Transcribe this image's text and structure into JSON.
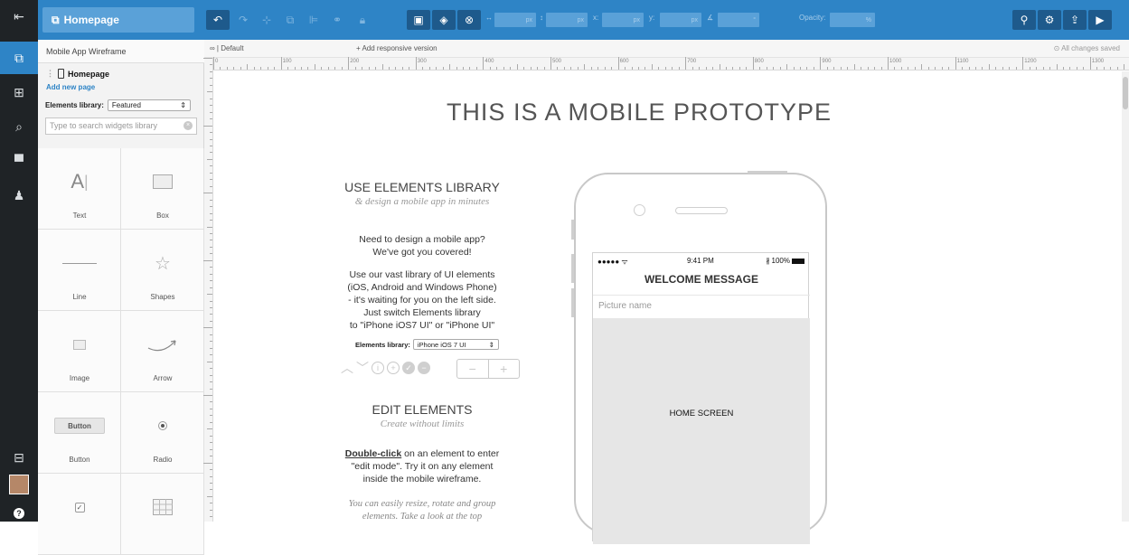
{
  "app": {
    "page_button": "Homepage",
    "project_title": "Mobile App Wireframe",
    "page_name": "Homepage",
    "add_page": "Add new page"
  },
  "toolbar": {
    "units": [
      "px",
      "px",
      "px",
      "px"
    ],
    "labels": {
      "x": "x:",
      "y": "y:",
      "opacity": "Opacity:",
      "percent": "%"
    }
  },
  "library": {
    "label": "Elements library:",
    "selected": "Featured",
    "search_placeholder": "Type to search widgets library",
    "widgets": [
      "Text",
      "Box",
      "Line",
      "Shapes",
      "Image",
      "Arrow",
      "Button",
      "Radio"
    ],
    "button_widget_label": "Button"
  },
  "canvas_head": {
    "default_tab": "∞ | Default",
    "add_responsive": "+ Add responsive version",
    "saved": "All changes saved"
  },
  "ruler": [
    "0",
    "100",
    "200",
    "300",
    "400",
    "500",
    "600",
    "700",
    "800",
    "900",
    "1000",
    "1100",
    "1200",
    "1300"
  ],
  "canvas": {
    "headline": "THIS IS A MOBILE  PROTOTYPE",
    "sec1_title": "USE ELEMENTS LIBRARY",
    "sec1_sub": "& design a mobile app in minutes",
    "sec1_p1_a": "Need to design a mobile app?",
    "sec1_p1_b": "We've got you covered!",
    "sec1_p2_a": "Use our vast library of UI elements",
    "sec1_p2_b": "(iOS, Android and Windows Phone)",
    "sec1_p2_c": "- it's waiting for you on the left side.",
    "sec1_p2_d": "Just switch Elements library",
    "sec1_p2_e": "to \"iPhone iOS7 UI\" or \"iPhone UI\"",
    "lib_label": "Elements library:",
    "lib_value": "iPhone iOS 7 UI",
    "sec2_title": "EDIT ELEMENTS",
    "sec2_sub": "Create without limits",
    "sec2_p1_bold": "Double-click",
    "sec2_p1_a": " on an element to enter",
    "sec2_p1_b": "\"edit mode\". Try it on any element",
    "sec2_p1_c": "inside the mobile wireframe.",
    "sec2_p2_a": "You can easily resize, rotate and group",
    "sec2_p2_b": "elements. Take a look at the top"
  },
  "phone": {
    "signal": "●●●●● ᯤ",
    "time": "9:41 PM",
    "battery": "100%",
    "welcome": "WELCOME MESSAGE",
    "picture_name": "Picture name",
    "home": "HOME SCREEN"
  },
  "colors": {
    "accent": "#2e84c6",
    "rail": "#1f2326"
  }
}
